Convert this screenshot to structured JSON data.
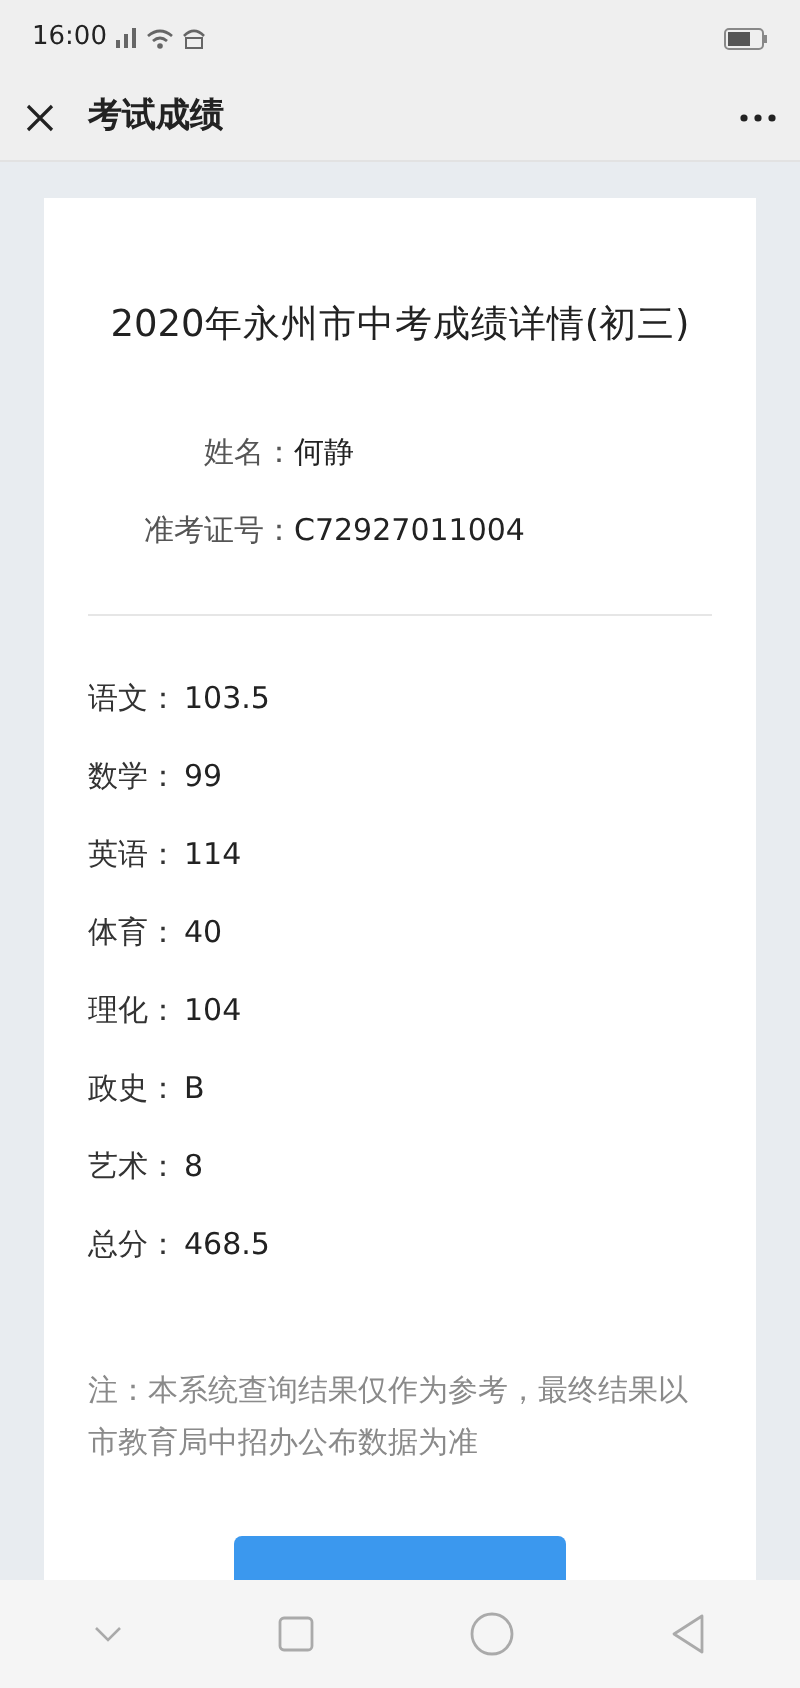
{
  "status_bar": {
    "time": "16:00"
  },
  "header": {
    "title": "考试成绩"
  },
  "card": {
    "title": "2020年永州市中考成绩详情(初三)",
    "info": [
      {
        "label": "姓名：",
        "value": "何静"
      },
      {
        "label": "准考证号：",
        "value": "C72927011004"
      }
    ],
    "scores": [
      {
        "label": "语文：",
        "value": "103.5"
      },
      {
        "label": "数学：",
        "value": "99"
      },
      {
        "label": "英语：",
        "value": "114"
      },
      {
        "label": "体育：",
        "value": "40"
      },
      {
        "label": "理化：",
        "value": "104"
      },
      {
        "label": "政史：",
        "value": "B"
      },
      {
        "label": "艺术：",
        "value": "8"
      },
      {
        "label": "总分：",
        "value": "468.5"
      }
    ],
    "note": "注：本系统查询结果仅作为参考，最终结果以市教育局中招办公布数据为准"
  }
}
